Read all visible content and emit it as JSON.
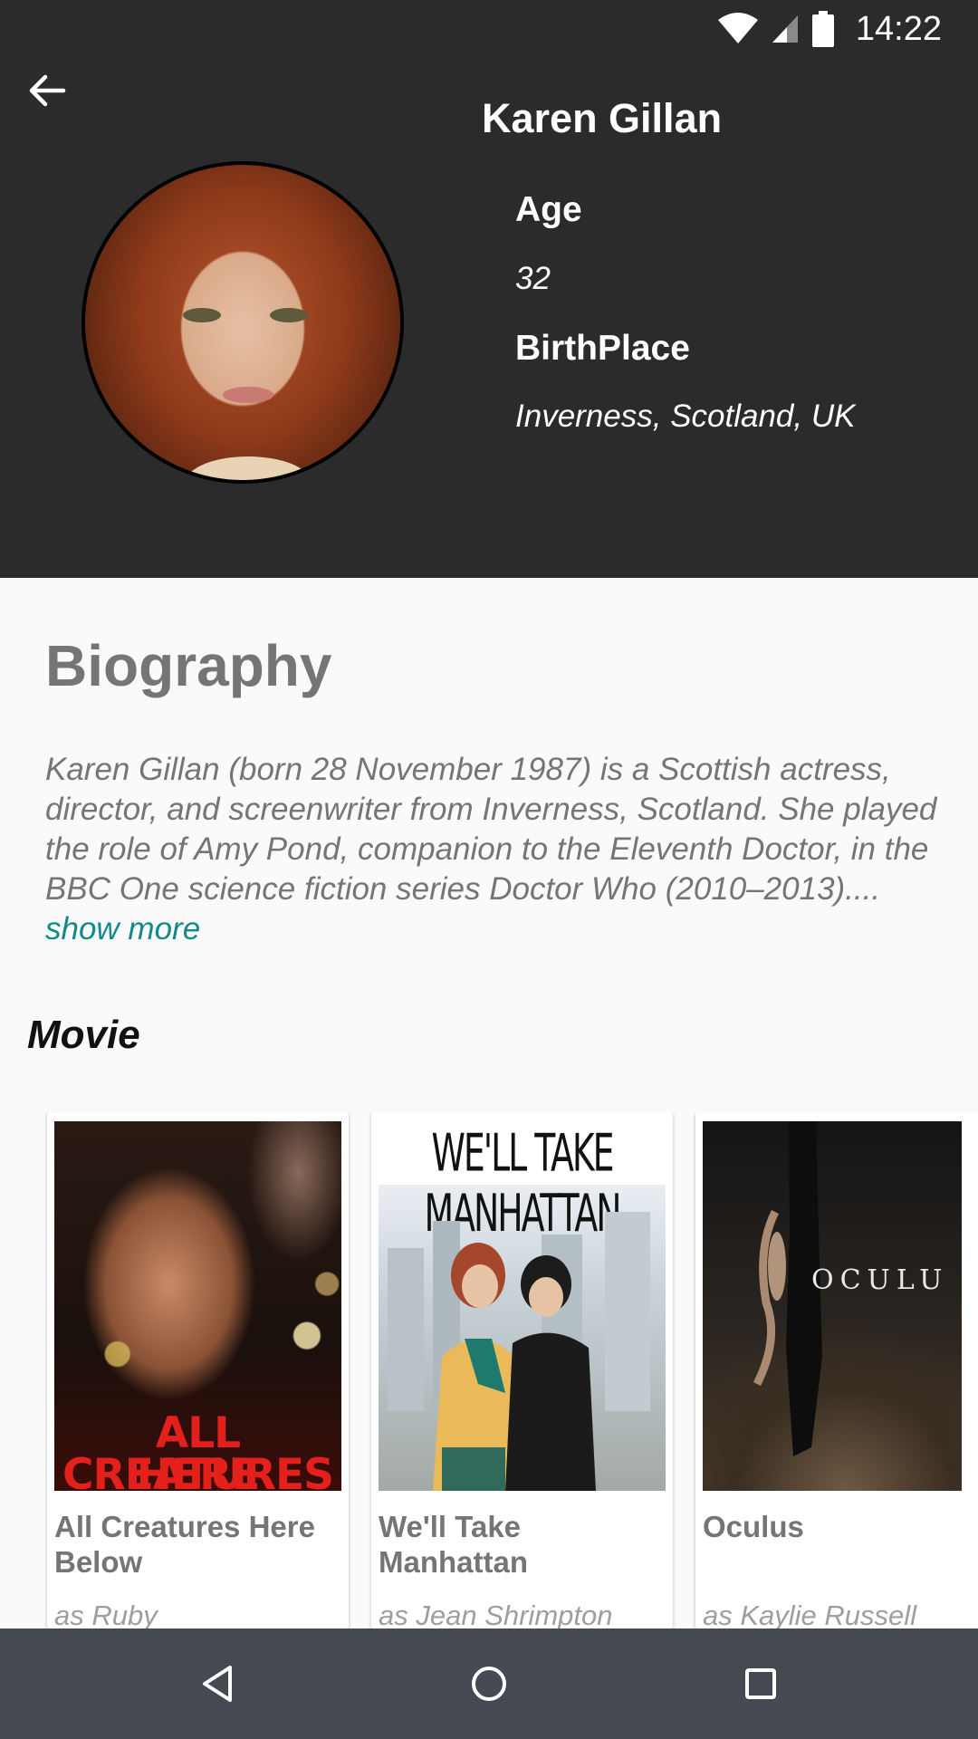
{
  "status_bar": {
    "time": "14:22",
    "icons": [
      "wifi-icon",
      "cell-signal-icon",
      "battery-icon"
    ]
  },
  "header": {
    "back_icon": "arrow-back-icon",
    "actor_name": "Karen Gillan",
    "age_label": "Age",
    "age_value": "32",
    "birthplace_label": "BirthPlace",
    "birthplace_value": "Inverness, Scotland, UK"
  },
  "biography": {
    "title": "Biography",
    "text": "Karen Gillan (born 28 November 1987) is a Scottish actress, director, and screenwriter from Inverness, Scotland. She played the role of Amy Pond, companion to the Eleventh Doctor, in the BBC One science fiction series Doctor Who (2010–2013)....",
    "show_more": "show more"
  },
  "movies": {
    "heading": "Movie",
    "items": [
      {
        "title": "All Creatures Here Below",
        "role": "as Ruby",
        "poster_text_line1": "ALL CREATURES",
        "poster_text_line2": "HERE BELOW"
      },
      {
        "title": "We'll Take Manhattan",
        "role": "as Jean Shrimpton",
        "poster_text": "WE'LL TAKE MANHATTAN"
      },
      {
        "title": "Oculus",
        "role": "as Kaylie Russell",
        "poster_text": "OCULU"
      }
    ]
  },
  "nav_bar": {
    "icons": [
      "back-triangle-icon",
      "home-circle-icon",
      "recents-square-icon"
    ]
  },
  "colors": {
    "header_bg": "#2b2b2b",
    "accent_link": "#138a8a",
    "nav_bg": "#454a52"
  }
}
